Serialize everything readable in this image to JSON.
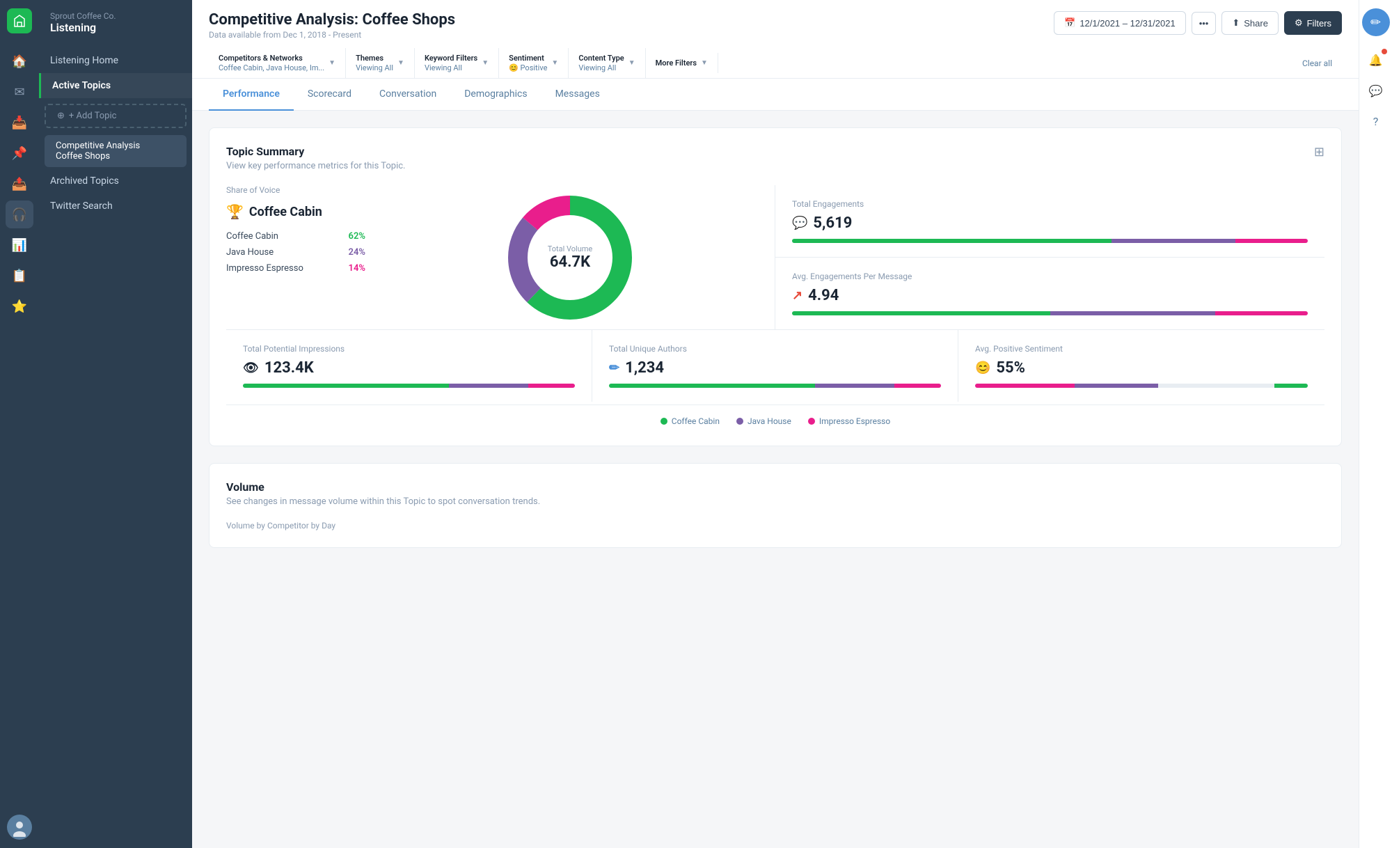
{
  "brand": {
    "company": "Sprout Coffee Co.",
    "app": "Listening"
  },
  "rail_icons": [
    {
      "name": "home-icon",
      "symbol": "🏠",
      "active": false
    },
    {
      "name": "messages-icon",
      "symbol": "✉",
      "active": false
    },
    {
      "name": "inbox-icon",
      "symbol": "📥",
      "active": false
    },
    {
      "name": "pin-icon",
      "symbol": "📌",
      "active": false
    },
    {
      "name": "send-icon",
      "symbol": "📤",
      "active": false
    },
    {
      "name": "listening-icon",
      "symbol": "🎧",
      "active": true
    },
    {
      "name": "analytics-icon",
      "symbol": "📊",
      "active": false
    },
    {
      "name": "tasks-icon",
      "symbol": "📋",
      "active": false
    },
    {
      "name": "reviews-icon",
      "symbol": "⭐",
      "active": false
    }
  ],
  "sidebar": {
    "listening_home_label": "Listening Home",
    "active_topics_label": "Active Topics",
    "add_topic_label": "+ Add Topic",
    "topics": [
      {
        "name": "Competitive Analysis Coffee Shops",
        "active": true
      }
    ],
    "archived_topics_label": "Archived Topics",
    "twitter_search_label": "Twitter Search"
  },
  "header": {
    "title": "Competitive Analysis: Coffee Shops",
    "subtitle": "Data available from Dec 1, 2018 - Present",
    "date_range": "12/1/2021 – 12/31/2021",
    "share_label": "Share",
    "filters_label": "Filters"
  },
  "filters": [
    {
      "label": "Competitors & Networks",
      "value": "Coffee Cabin, Java House, Im..."
    },
    {
      "label": "Themes",
      "value": "Viewing All"
    },
    {
      "label": "Keyword Filters",
      "value": "Viewing All"
    },
    {
      "label": "Sentiment",
      "value": "😊 Positive"
    },
    {
      "label": "Content Type",
      "value": "Viewing All"
    },
    {
      "label": "More Filters",
      "value": ""
    }
  ],
  "clear_all_label": "Clear all",
  "tabs": [
    {
      "label": "Performance",
      "active": true
    },
    {
      "label": "Scorecard",
      "active": false
    },
    {
      "label": "Conversation",
      "active": false
    },
    {
      "label": "Demographics",
      "active": false
    },
    {
      "label": "Messages",
      "active": false
    }
  ],
  "topic_summary": {
    "title": "Topic Summary",
    "subtitle": "View key performance metrics for this Topic.",
    "share_of_voice_label": "Share of Voice",
    "winner": "Coffee Cabin",
    "competitors": [
      {
        "name": "Coffee Cabin",
        "pct": "62%",
        "color": "green",
        "segment": 62
      },
      {
        "name": "Java House",
        "pct": "24%",
        "color": "purple",
        "segment": 24
      },
      {
        "name": "Impresso Espresso",
        "pct": "14%",
        "color": "pink",
        "segment": 14
      }
    ],
    "donut": {
      "total_label": "Total Volume",
      "total_value": "64.7K"
    },
    "metrics": [
      {
        "label": "Total Engagements",
        "value": "5,619",
        "icon": "💬",
        "bar": [
          62,
          24,
          14
        ]
      },
      {
        "label": "Avg. Engagements Per Message",
        "value": "4.94",
        "icon": "↗",
        "bar": [
          62,
          24,
          14
        ]
      }
    ],
    "stats": [
      {
        "label": "Total Potential Impressions",
        "value": "123.4K",
        "icon": "👁",
        "bar": [
          62,
          24,
          14
        ]
      },
      {
        "label": "Total Unique Authors",
        "value": "1,234",
        "icon": "✏",
        "bar": [
          62,
          24,
          14
        ]
      },
      {
        "label": "Avg. Positive Sentiment",
        "value": "55%",
        "icon": "😊",
        "bar": [
          20,
          30,
          10
        ]
      }
    ],
    "legend": [
      {
        "label": "Coffee Cabin",
        "color": "#1db954"
      },
      {
        "label": "Java House",
        "color": "#7b5ea7"
      },
      {
        "label": "Impresso Espresso",
        "color": "#e91e8c"
      }
    ]
  },
  "volume": {
    "title": "Volume",
    "subtitle": "See changes in message volume within this Topic to spot conversation trends.",
    "by_label": "Volume by Competitor by Day"
  }
}
